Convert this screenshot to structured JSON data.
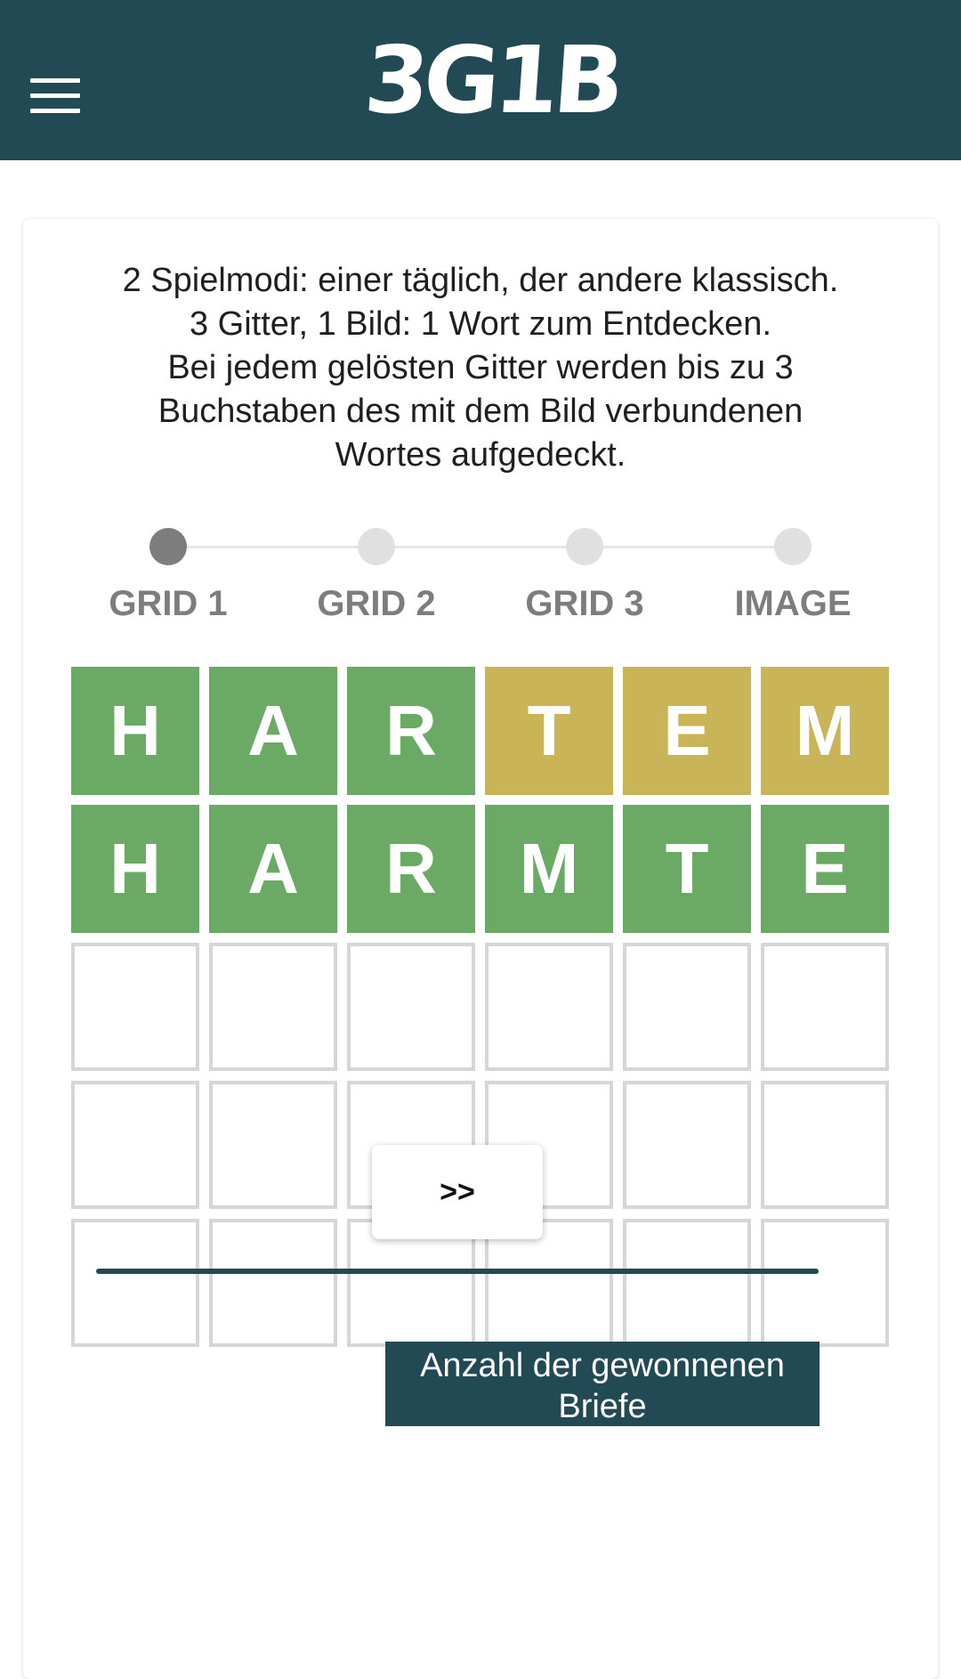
{
  "header": {
    "logo": "3G1B",
    "menu_icon": "hamburger-menu-icon",
    "background_color": "#224a55"
  },
  "intro": {
    "lines": [
      "2 Spielmodi: einer täglich, der andere klassisch.",
      "3 Gitter, 1 Bild: 1 Wort zum Entdecken.",
      "Bei jedem gelösten Gitter werden bis zu 3",
      "Buchstaben des mit dem Bild verbundenen",
      "Wortes aufgedeckt."
    ]
  },
  "stepper": {
    "active_index": 0,
    "steps": [
      {
        "label": "GRID 1"
      },
      {
        "label": "GRID 2"
      },
      {
        "label": "GRID 3"
      },
      {
        "label": "IMAGE"
      }
    ]
  },
  "grid": {
    "colors": {
      "correct": "#6aaa64",
      "present": "#c9b458",
      "empty_border": "#d6d6d6"
    },
    "rows": [
      [
        {
          "letter": "H",
          "state": "correct"
        },
        {
          "letter": "A",
          "state": "correct"
        },
        {
          "letter": "R",
          "state": "correct"
        },
        {
          "letter": "T",
          "state": "present"
        },
        {
          "letter": "E",
          "state": "present"
        },
        {
          "letter": "M",
          "state": "present"
        }
      ],
      [
        {
          "letter": "H",
          "state": "correct"
        },
        {
          "letter": "A",
          "state": "correct"
        },
        {
          "letter": "R",
          "state": "correct"
        },
        {
          "letter": "M",
          "state": "correct"
        },
        {
          "letter": "T",
          "state": "correct"
        },
        {
          "letter": "E",
          "state": "correct"
        }
      ],
      [
        {
          "letter": "",
          "state": "empty"
        },
        {
          "letter": "",
          "state": "empty"
        },
        {
          "letter": "",
          "state": "empty"
        },
        {
          "letter": "",
          "state": "empty"
        },
        {
          "letter": "",
          "state": "empty"
        },
        {
          "letter": "",
          "state": "empty"
        }
      ],
      [
        {
          "letter": "",
          "state": "empty"
        },
        {
          "letter": "",
          "state": "empty"
        },
        {
          "letter": "",
          "state": "empty"
        },
        {
          "letter": "",
          "state": "empty"
        },
        {
          "letter": "",
          "state": "empty"
        },
        {
          "letter": "",
          "state": "empty"
        }
      ],
      [
        {
          "letter": "",
          "state": "empty"
        },
        {
          "letter": "",
          "state": "empty"
        },
        {
          "letter": "",
          "state": "empty"
        },
        {
          "letter": "",
          "state": "empty"
        },
        {
          "letter": "",
          "state": "empty"
        },
        {
          "letter": "",
          "state": "empty"
        }
      ]
    ]
  },
  "next_button": {
    "label": ">>"
  },
  "won_letters": {
    "label": "Anzahl der gewonnenen Briefe"
  }
}
